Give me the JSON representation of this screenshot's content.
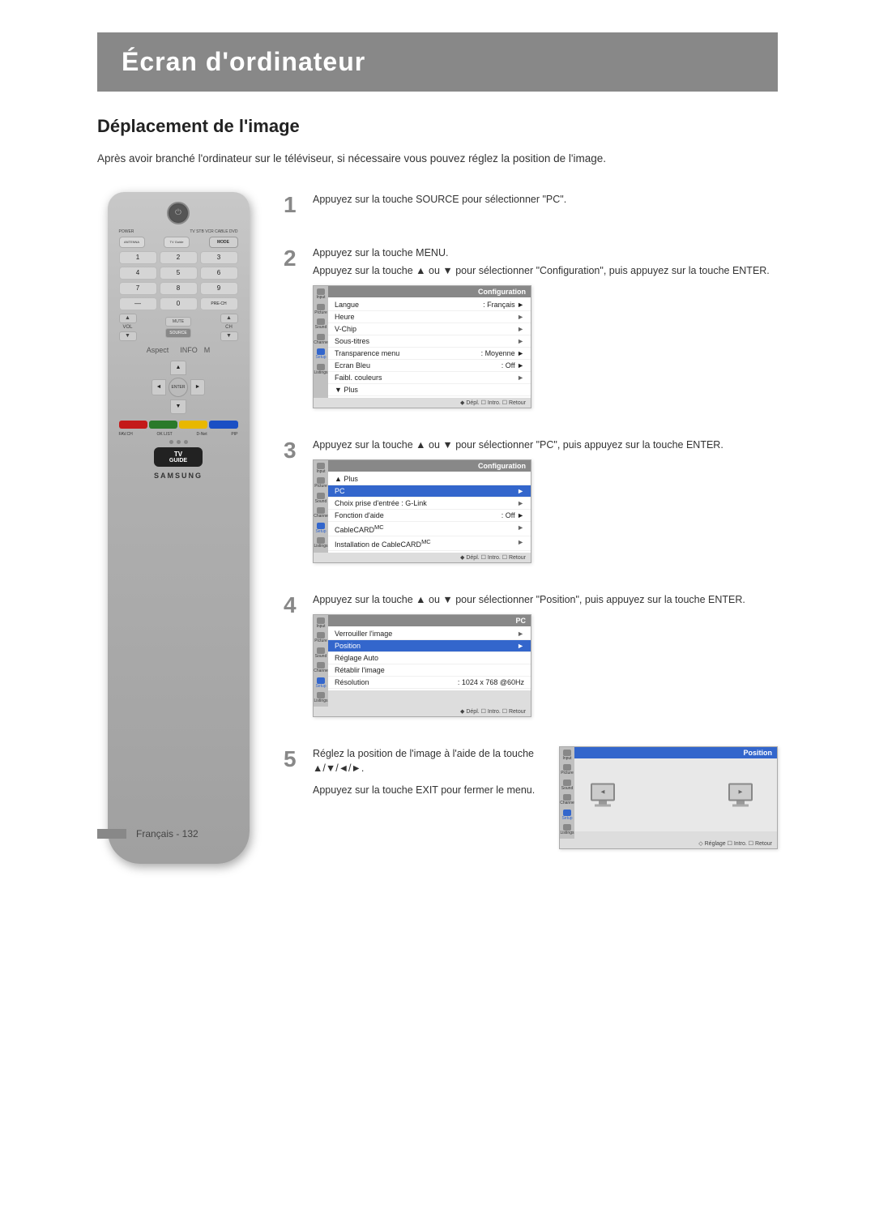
{
  "header": {
    "title": "Écran d'ordinateur",
    "bg_color": "#888888"
  },
  "section": {
    "title": "Déplacement de l'image",
    "intro": "Après avoir branché l'ordinateur sur le téléviseur, si nécessaire vous pouvez réglez la position de l'image."
  },
  "steps": [
    {
      "number": "1",
      "text": "Appuyez sur la touche SOURCE pour sélectionner \"PC\"."
    },
    {
      "number": "2",
      "text_main": "Appuyez sur la touche MENU.",
      "text_sub": "Appuyez sur la touche ▲ ou ▼ pour sélectionner \"Configuration\", puis appuyez sur la touche ENTER.",
      "screen_title": "Configuration",
      "menu_items": [
        {
          "label": "Langue",
          "value": ": Français",
          "arrow": "►"
        },
        {
          "label": "Heure",
          "value": "",
          "arrow": "►"
        },
        {
          "label": "V-Chip",
          "value": "",
          "arrow": "►"
        },
        {
          "label": "Sous-titres",
          "value": "",
          "arrow": "►"
        },
        {
          "label": "Transparence menu",
          "value": ": Moyenne",
          "arrow": "►"
        },
        {
          "label": "Ecran Bleu",
          "value": ": Off",
          "arrow": "►"
        },
        {
          "label": "Faibl. couleurs",
          "value": "",
          "arrow": "►"
        },
        {
          "label": "▼ Plus",
          "value": "",
          "arrow": ""
        }
      ],
      "left_icons": [
        "Input",
        "Picture",
        "Sound",
        "Channe",
        "Setup",
        "Listings"
      ],
      "footer": "◆ Dépl.   ☐ Intro.   ☐ Retour"
    },
    {
      "number": "3",
      "text": "Appuyez sur la touche ▲ ou ▼ pour sélectionner \"PC\", puis appuyez sur la touche ENTER.",
      "screen_title": "Configuration",
      "menu_items": [
        {
          "label": "▲ Plus",
          "value": "",
          "arrow": ""
        },
        {
          "label": "PC",
          "value": "",
          "arrow": "►",
          "highlighted": true
        },
        {
          "label": "Choix prise d'entrée : G-Link",
          "value": "",
          "arrow": "►"
        },
        {
          "label": "Fonction d'aide",
          "value": ": Off",
          "arrow": "►"
        },
        {
          "label": "CableCARDMC",
          "value": "",
          "arrow": "►"
        },
        {
          "label": "Installation de CableCARDMC",
          "value": "",
          "arrow": "►"
        }
      ],
      "left_icons": [
        "Input",
        "Picture",
        "Sound",
        "Channe",
        "Setup",
        "Listings"
      ],
      "footer": "◆ Dépl.   ☐ Intro.   ☐ Retour"
    },
    {
      "number": "4",
      "text": "Appuyez sur la touche ▲ ou ▼ pour sélectionner \"Position\", puis appuyez sur la touche ENTER.",
      "screen_title": "PC",
      "menu_items": [
        {
          "label": "Verrouiller l'image",
          "value": "",
          "arrow": "►"
        },
        {
          "label": "Position",
          "value": "",
          "arrow": "►",
          "highlighted": true
        },
        {
          "label": "Réglage Auto",
          "value": "",
          "arrow": ""
        },
        {
          "label": "Rétablir l'image",
          "value": "",
          "arrow": ""
        },
        {
          "label": "Résolution",
          "value": ": 1024 x 768 @60Hz",
          "arrow": ""
        }
      ],
      "left_icons": [
        "Input",
        "Picture",
        "Sound",
        "Channe",
        "Setup",
        "Listings"
      ],
      "footer": "◆ Dépl.   ☐ Intro.   ☐ Retour"
    },
    {
      "number": "5",
      "text1": "Réglez la position de l'image à l'aide de la touche ▲/▼/◄/►.",
      "text2": "Appuyez sur la touche EXIT pour fermer le menu.",
      "screen_title": "Position",
      "left_icons": [
        "Input",
        "Picture",
        "Sound",
        "Channe",
        "Setup",
        "Listings"
      ],
      "footer": "◇ Réglage   ☐ Intro.   ☐ Retour"
    }
  ],
  "footer": {
    "text": "Français - 132"
  },
  "remote": {
    "power_label": "POWER",
    "labels": [
      "TV STB VCR CABLE DVD"
    ],
    "antenna": "ANTENNA",
    "tv_guide": "TV Guide",
    "mode": "MODE",
    "mute": "MUTE",
    "vol": "VOL",
    "source": "SOURCE",
    "info": "INFO",
    "enter": "ENTER",
    "fav_ch": "FAV.CH",
    "ok_list": "OK LIST",
    "d_net": "D-Net",
    "pip": "PIP",
    "tv_guide_logo": "TV GUIDE",
    "samsung": "SAMSUNG"
  }
}
